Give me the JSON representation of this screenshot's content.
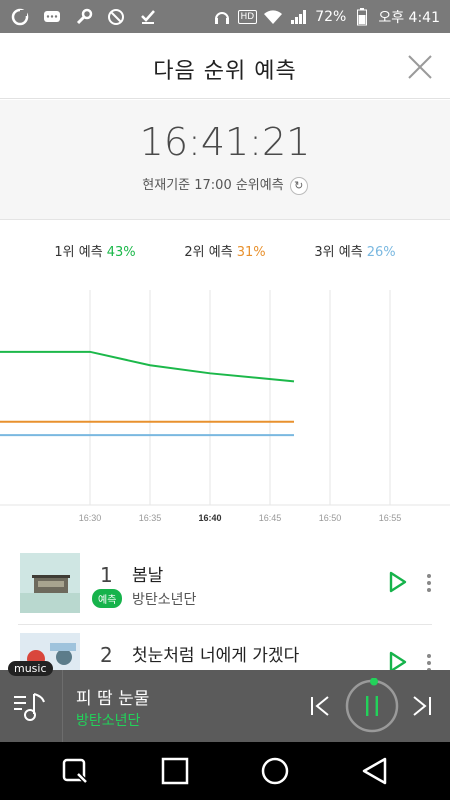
{
  "statusbar": {
    "battery": "72%",
    "time": "오후 4:41",
    "hd": "HD"
  },
  "header": {
    "title": "다음 순위 예측"
  },
  "timer": {
    "clock": "16:41:21",
    "note": "현재기준 17:00 순위예측"
  },
  "legend": [
    {
      "label": "1위 예측",
      "pct": "43%",
      "color": "#1cb84a"
    },
    {
      "label": "2위 예측",
      "pct": "31%",
      "color": "#e8912e"
    },
    {
      "label": "3위 예측",
      "pct": "26%",
      "color": "#7ab8e0"
    }
  ],
  "chart_data": {
    "type": "line",
    "x_ticks": [
      "16:30",
      "16:35",
      "16:40",
      "16:45",
      "16:50",
      "16:55"
    ],
    "highlight_tick": "16:40",
    "series": [
      {
        "name": "1위 예측",
        "color": "#1cb84a",
        "points": [
          [
            0,
            57
          ],
          [
            10,
            52
          ],
          [
            20,
            49
          ],
          [
            34,
            46
          ]
        ]
      },
      {
        "name": "2위 예측",
        "color": "#e8912e",
        "points": [
          [
            0,
            31
          ],
          [
            34,
            31
          ]
        ]
      },
      {
        "name": "3위 예측",
        "color": "#7ab8e0",
        "points": [
          [
            0,
            26
          ],
          [
            34,
            26
          ]
        ]
      }
    ],
    "x_range": [
      -15,
      60
    ],
    "y_range": [
      0,
      80
    ],
    "grid": true
  },
  "list": [
    {
      "rank": "1",
      "title": "봄날",
      "artist": "방탄소년단",
      "tag": "예측"
    },
    {
      "rank": "2",
      "title": "첫눈처럼 너에게 가겠다",
      "artist": ""
    }
  ],
  "player": {
    "tag": "music",
    "song": "피 땀 눈물",
    "artist": "방탄소년단",
    "accent": "#22d25a"
  }
}
